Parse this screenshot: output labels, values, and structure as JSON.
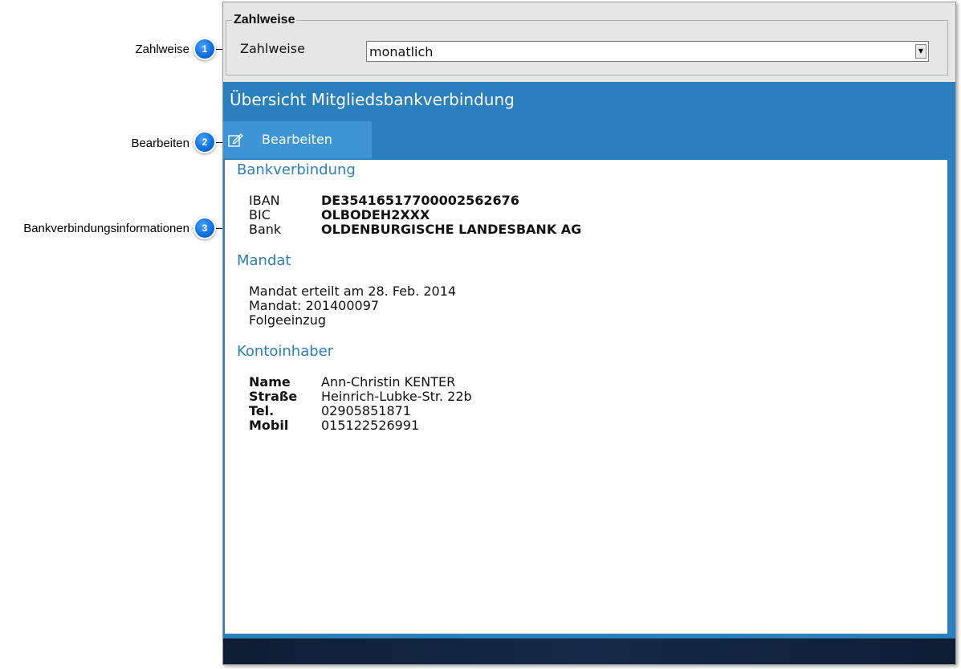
{
  "callouts": [
    {
      "number": "1",
      "label": "Zahlweise"
    },
    {
      "number": "2",
      "label": "Bearbeiten"
    },
    {
      "number": "3",
      "label": "Bankverbindungsinformationen"
    }
  ],
  "payment": {
    "legend": "Zahlweise",
    "field_label": "Zahlweise",
    "selected": "monatlich"
  },
  "header": {
    "title": "Übersicht Mitgliedsbankverbindung"
  },
  "toolbar": {
    "edit_label": "Bearbeiten",
    "edit_icon": "edit-icon"
  },
  "bank": {
    "title": "Bankverbindung",
    "rows": [
      {
        "key": "IBAN",
        "value": "DE35416517700002562676"
      },
      {
        "key": "BIC",
        "value": "OLBODEH2XXX"
      },
      {
        "key": "Bank",
        "value": "OLDENBURGISCHE LANDESBANK AG"
      }
    ]
  },
  "mandate": {
    "title": "Mandat",
    "lines": [
      "Mandat erteilt am 28. Feb. 2014",
      "Mandat: 201400097",
      "Folgeeinzug"
    ]
  },
  "holder": {
    "title": "Kontoinhaber",
    "rows": [
      {
        "key": "Name",
        "value": "Ann-Christin KENTER"
      },
      {
        "key": "Straße",
        "value": "Heinrich-Lubke-Str. 22b"
      },
      {
        "key": "Tel.",
        "value": "02905851871"
      },
      {
        "key": "Mobil",
        "value": "015122526991"
      }
    ]
  },
  "colors": {
    "accent": "#2a7fbd",
    "tab_active": "#3d95d6",
    "badge": "#0a6ee0",
    "footer": "#0d1d33"
  }
}
